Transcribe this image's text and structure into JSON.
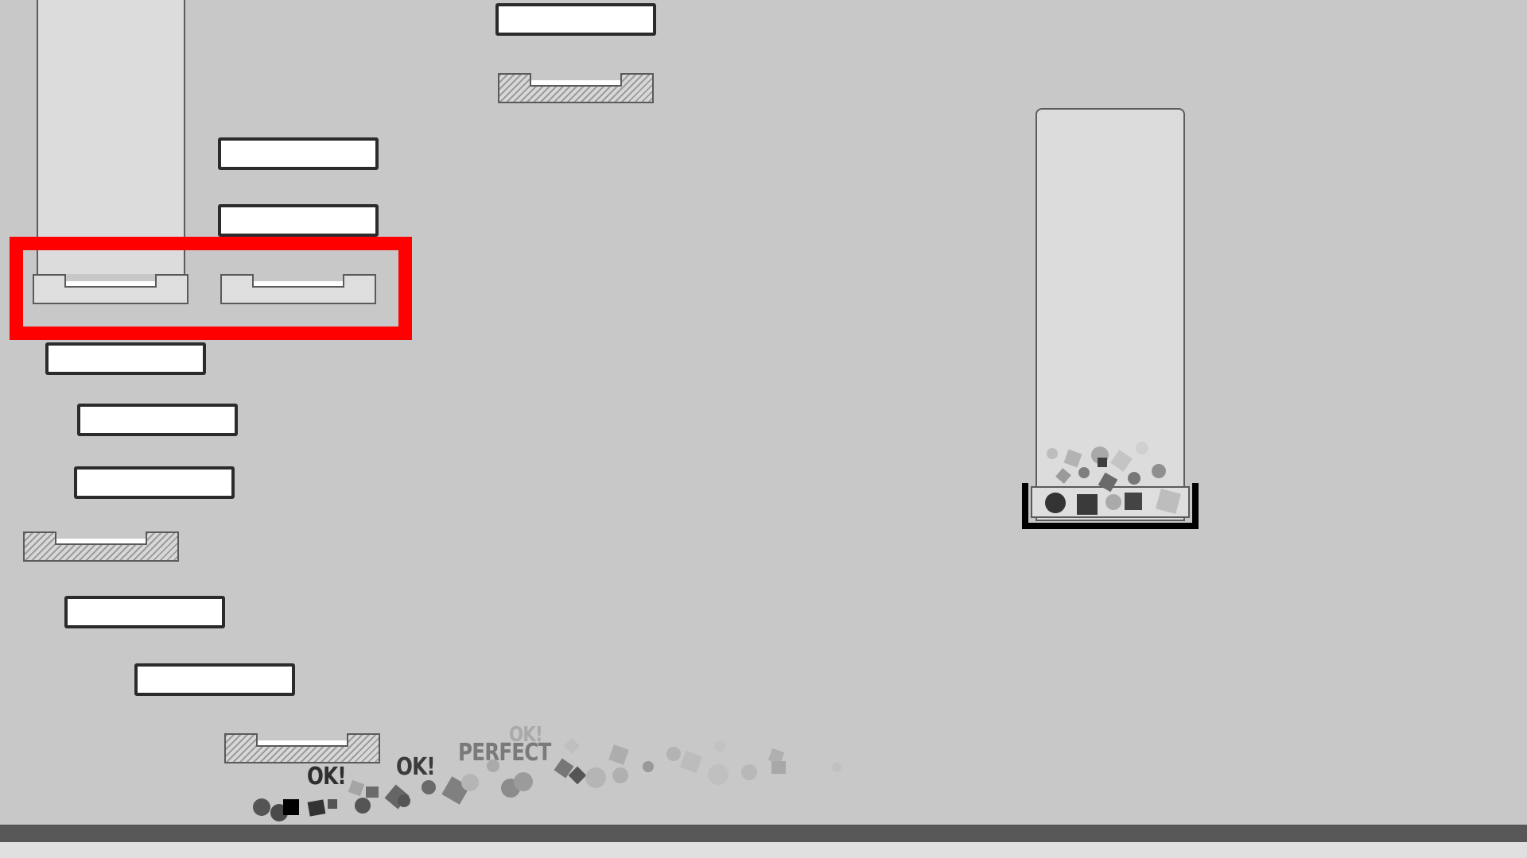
{
  "scene": {
    "popups": [
      "OK!",
      "OK!",
      "PERFECT",
      "OK!"
    ]
  },
  "colors": {
    "background": "#c8c8c8",
    "platform_fill": "#ffffff",
    "platform_border": "#2b2b2b",
    "floor": "#575757",
    "highlight": "#ff0000"
  }
}
